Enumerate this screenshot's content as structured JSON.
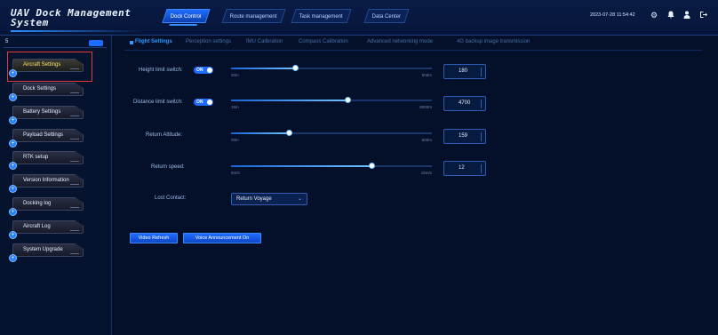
{
  "app": {
    "title": "UAV Dock Management System"
  },
  "header": {
    "nav": [
      "Dock Control",
      "Route management",
      "Task management",
      "Data Center"
    ],
    "active_nav": "Dock Control",
    "datetime": "2023-07-28 11:54:42"
  },
  "sidebar": {
    "count": "5",
    "items": [
      {
        "label": "Aircraft Settings",
        "active": true
      },
      {
        "label": "Dock Settings"
      },
      {
        "label": "Battery Settings"
      },
      {
        "label": "Payload Settings"
      },
      {
        "label": "RTK setup"
      },
      {
        "label": "Version Information"
      },
      {
        "label": "Docking log"
      },
      {
        "label": "Aircraft Log"
      },
      {
        "label": "System Upgrade"
      }
    ]
  },
  "tabs": [
    "Flight Settings",
    "Perception settings",
    "IMU Calibration",
    "Compass Calibration",
    "Advanced networking mode",
    "4G backup image transmission"
  ],
  "form": {
    "height_limit": {
      "label": "Height limit switch:",
      "switch": "ON",
      "min": "20m",
      "max": "500m",
      "value": "180",
      "fraction": 0.32
    },
    "distance_limit": {
      "label": "Distance limit switch:",
      "switch": "ON",
      "min": "15m",
      "max": "8000m",
      "value": "4700",
      "fraction": 0.58
    },
    "return_altitude": {
      "label": "Return Altitude:",
      "min": "20m",
      "max": "500m",
      "value": "159",
      "fraction": 0.29
    },
    "return_speed": {
      "label": "Return speed:",
      "min": "5m/s",
      "max": "15m/s",
      "value": "12",
      "fraction": 0.7
    },
    "lost_contact": {
      "label": "Lost Contact:",
      "value": "Return Voyage"
    }
  },
  "buttons": {
    "video_refresh": "Video Refresh",
    "voice_announcement": "Voice Announcement On"
  },
  "colors": {
    "accent": "#1f6dff",
    "highlight": "#e13a3a"
  }
}
